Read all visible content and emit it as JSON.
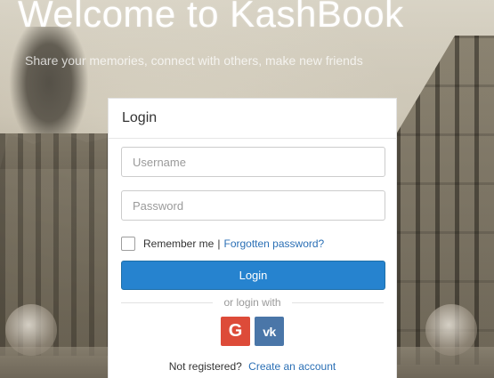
{
  "header": {
    "title": "Welcome to KashBook",
    "tagline": "Share your memories, connect with others, make new friends"
  },
  "login_panel": {
    "title": "Login",
    "username_placeholder": "Username",
    "password_placeholder": "Password",
    "remember_label": "Remember me",
    "separator": "|",
    "forgot_link": "Forgotten password?",
    "login_button": "Login",
    "or_login_with": "or login with",
    "social": [
      {
        "label": "G",
        "icon": "google-icon",
        "color": "#dd4b39"
      },
      {
        "label": "vk",
        "icon": "vk-icon",
        "color": "#4a76a8"
      }
    ],
    "not_registered": "Not registered?",
    "create_account_link": "Create an account"
  },
  "colors": {
    "primary": "#2683cf",
    "link": "#2a6fb5"
  }
}
